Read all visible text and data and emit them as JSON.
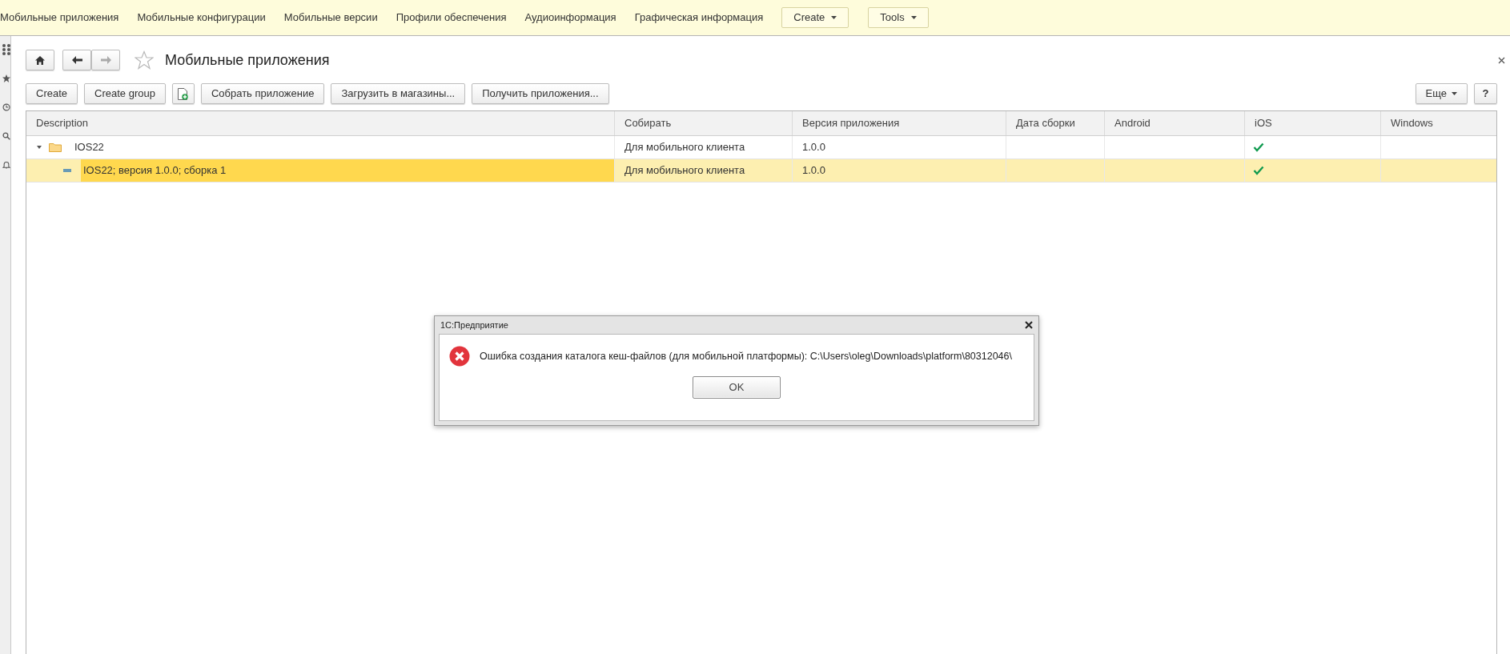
{
  "top_menu": {
    "items": [
      {
        "label": "Мобильные приложения"
      },
      {
        "label": "Мобильные конфигурации"
      },
      {
        "label": "Мобильные версии"
      },
      {
        "label": "Профили обеспечения"
      },
      {
        "label": "Аудиоинформация"
      },
      {
        "label": "Графическая информация"
      }
    ],
    "dropdowns": [
      {
        "label": "Create"
      },
      {
        "label": "Tools"
      }
    ]
  },
  "form": {
    "title": "Мобильные приложения",
    "favorite": false,
    "toolbar": [
      {
        "kind": "text",
        "label": "Create"
      },
      {
        "kind": "text",
        "label": "Create group"
      },
      {
        "kind": "icon"
      },
      {
        "kind": "text",
        "label": "Собрать приложение"
      },
      {
        "kind": "text",
        "label": "Загрузить в магазины..."
      },
      {
        "kind": "text",
        "label": "Получить приложения..."
      }
    ],
    "more_button": "Еще",
    "help_button": "?"
  },
  "table": {
    "columns": [
      "Description",
      "Собирать",
      "Версия приложения",
      "Дата сборки",
      "Android",
      "iOS",
      "Windows"
    ],
    "rows": [
      {
        "kind": "group",
        "expanded": true,
        "selected": false,
        "description": "IOS22",
        "build": "Для мобильного клиента",
        "version": "1.0.0",
        "ios": true,
        "children": [
          {
            "kind": "item",
            "selected": true,
            "description": "IOS22; версия 1.0.0; сборка 1",
            "build": "Для мобильного клиента",
            "version": "1.0.0",
            "ios": true
          }
        ]
      }
    ]
  },
  "dialog": {
    "title": "1С:Предприятие",
    "message": "Ошибка создания каталога кеш-файлов (для мобильной платформы): C:\\Users\\oleg\\Downloads\\platform\\80312046\\",
    "button": "OK"
  }
}
